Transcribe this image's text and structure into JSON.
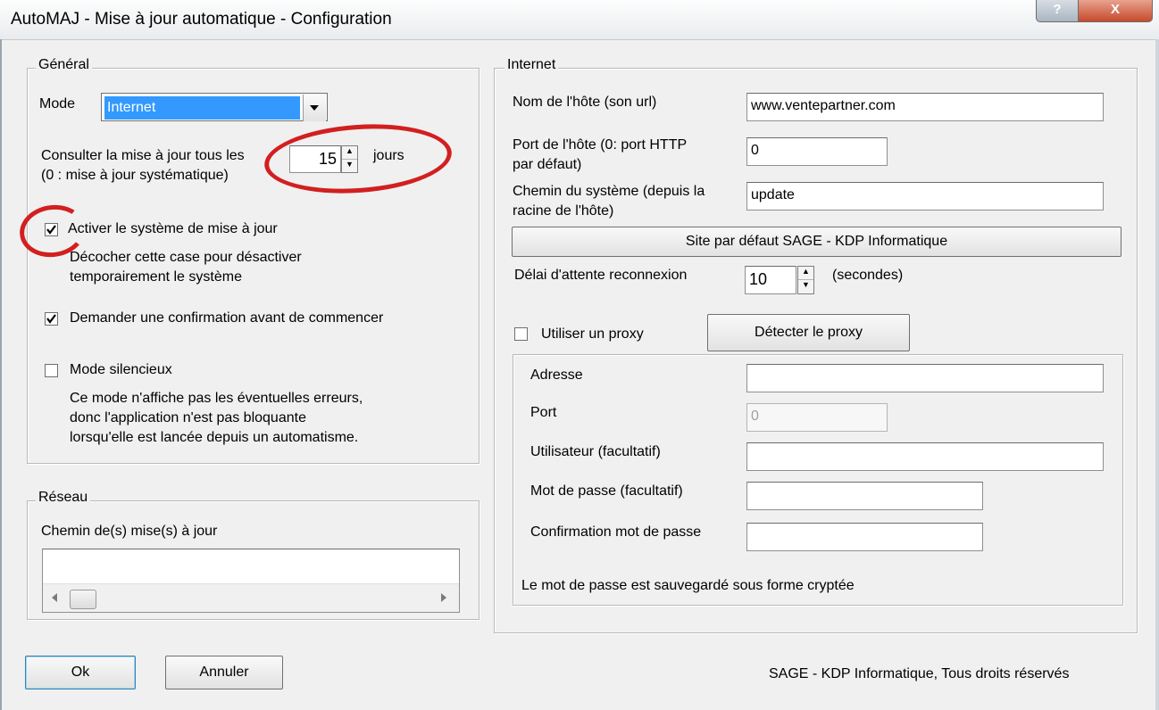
{
  "window": {
    "title": "AutoMAJ - Mise à jour automatique - Configuration",
    "help_label": "?",
    "close_label": "X"
  },
  "general": {
    "group_title": "Général",
    "mode_label": "Mode",
    "mode_value": "Internet",
    "check_label": "Consulter la mise à jour tous les",
    "check_sub": "(0 : mise à jour systématique)",
    "days_value": "15",
    "days_unit": "jours",
    "activate": {
      "checked": true,
      "label": "Activer le système de mise à jour",
      "desc1": "Décocher cette case pour désactiver",
      "desc2": "temporairement le système"
    },
    "confirm": {
      "checked": true,
      "label": "Demander une confirmation avant de commencer"
    },
    "silent": {
      "checked": false,
      "label": "Mode silencieux",
      "desc1": "Ce mode n'affiche pas les éventuelles erreurs,",
      "desc2": "donc l'application n'est pas bloquante",
      "desc3": "lorsqu'elle est lancée depuis un automatisme."
    }
  },
  "network": {
    "group_title": "Réseau",
    "path_label": "Chemin de(s) mise(s) à jour",
    "path_value": ""
  },
  "internet": {
    "group_title": "Internet",
    "host_label": "Nom de l'hôte (son url)",
    "host_value": "www.ventepartner.com",
    "port_label1": "Port de l'hôte (0: port HTTP",
    "port_label2": "par défaut)",
    "port_value": "0",
    "path_label1": "Chemin du système (depuis la",
    "path_label2": "racine de l'hôte)",
    "path_value": "update",
    "default_site_button": "Site par défaut SAGE - KDP Informatique",
    "timeout_label": "Délai d'attente reconnexion",
    "timeout_value": "10",
    "timeout_unit": "(secondes)",
    "use_proxy": {
      "checked": false,
      "label": "Utiliser un proxy"
    },
    "detect_proxy_button": "Détecter le proxy",
    "proxy": {
      "address_label": "Adresse",
      "address_value": "",
      "port_label": "Port",
      "port_value": "0",
      "user_label": "Utilisateur (facultatif)",
      "user_value": "",
      "password_label": "Mot de passe (facultatif)",
      "password_value": "",
      "confirm_label": "Confirmation mot de passe",
      "confirm_value": "",
      "note": "Le mot de passe est sauvegardé sous forme cryptée"
    }
  },
  "footer": {
    "ok_button": "Ok",
    "cancel_button": "Annuler",
    "copyright": "SAGE - KDP Informatique, Tous droits réservés"
  },
  "colors": {
    "annotation": "#d21f1f",
    "selection": "#3399ff",
    "dialog_bg": "#f0f0f0"
  }
}
